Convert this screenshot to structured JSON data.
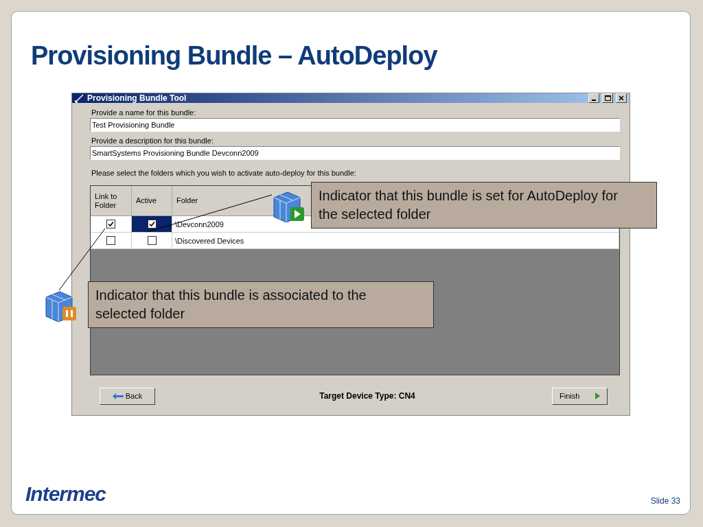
{
  "slide": {
    "title": "Provisioning Bundle – AutoDeploy",
    "logo": "Intermec",
    "slide_number": "Slide 33"
  },
  "window": {
    "title": "Provisioning Bundle Tool",
    "name_label": "Provide a name for this bundle:",
    "name_value": "Test Provisioning Bundle",
    "description_label": "Provide a description for this bundle:",
    "description_value": "SmartSystems Provisioning Bundle Devconn2009",
    "folders_label": "Please select the folders which you wish to activate auto-deploy for this bundle:",
    "table": {
      "columns": [
        "Link to Folder",
        "Active",
        "Folder"
      ],
      "rows": [
        {
          "linked": true,
          "active": true,
          "folder": "\\Devconn2009",
          "selected": true
        },
        {
          "linked": false,
          "active": false,
          "folder": "\\Discovered Devices",
          "selected": false
        }
      ]
    },
    "back_button": "Back",
    "target_device": "Target Device Type: CN4",
    "finish_button": "Finish"
  },
  "callouts": [
    {
      "kind": "autodeploy",
      "text": "Indicator that this bundle is set for AutoDeploy for the selected folder"
    },
    {
      "kind": "associated",
      "text": "Indicator that this bundle is associated to the selected folder"
    }
  ]
}
